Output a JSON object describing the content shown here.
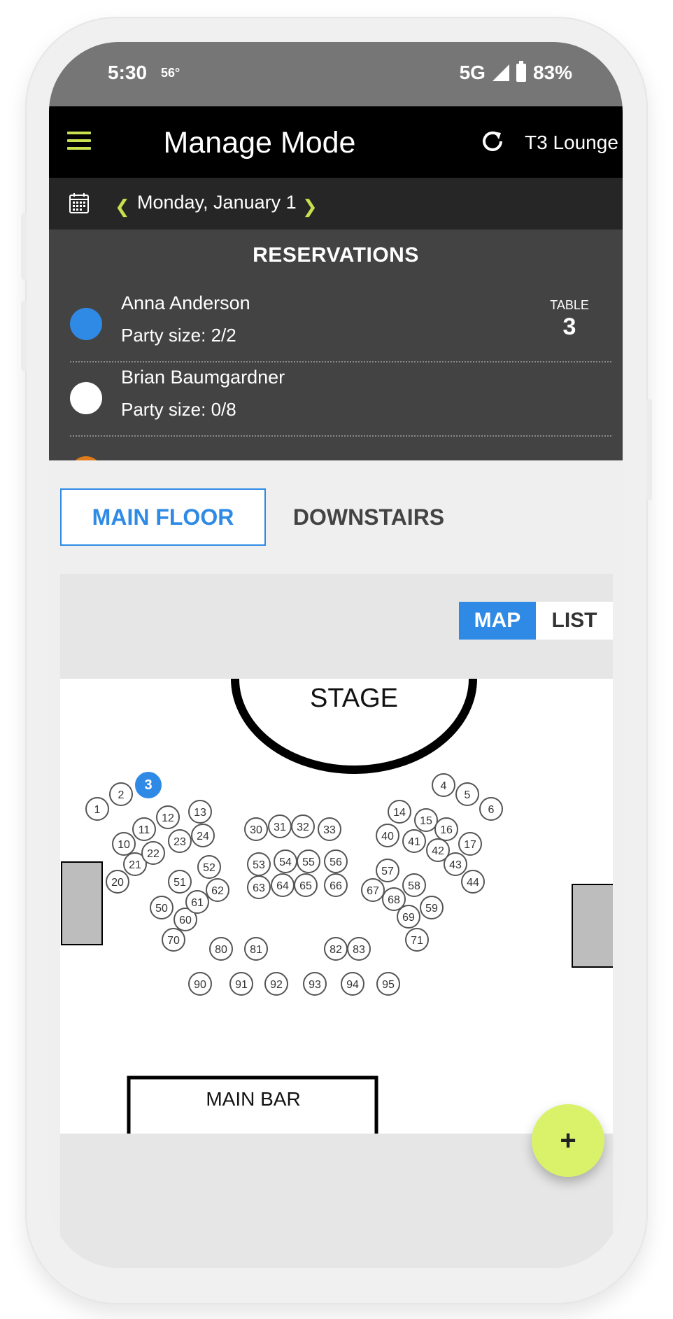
{
  "status": {
    "time": "5:30",
    "temp": "56°",
    "network": "5G",
    "battery": "83%"
  },
  "appbar": {
    "title": "Manage Mode",
    "venue": "T3 Lounge"
  },
  "datebar": {
    "date": "Monday, January 1"
  },
  "reservations": {
    "title": "RESERVATIONS",
    "items": [
      {
        "name": "Anna Anderson",
        "party": "Party size: 2/2",
        "table_label": "TABLE",
        "table": "3",
        "color": "#2f8ae6"
      },
      {
        "name": "Brian Baumgardner",
        "party": "Party size: 0/8",
        "table_label": "",
        "table": "",
        "color": "#ffffff"
      },
      {
        "name": "",
        "party": "",
        "table_label": "",
        "table": "",
        "color": "#e07b1a"
      }
    ]
  },
  "floor_tabs": {
    "main": "MAIN FLOOR",
    "downstairs": "DOWNSTAIRS"
  },
  "view_toggle": {
    "map": "MAP",
    "list": "LIST"
  },
  "floor_plan": {
    "stage_label": "STAGE",
    "bar_label": "MAIN BAR",
    "highlighted_table": "3",
    "tables": [
      "1",
      "2",
      "3",
      "4",
      "5",
      "6",
      "10",
      "11",
      "12",
      "13",
      "14",
      "15",
      "16",
      "17",
      "20",
      "21",
      "22",
      "23",
      "24",
      "30",
      "31",
      "32",
      "33",
      "40",
      "41",
      "42",
      "43",
      "44",
      "50",
      "51",
      "52",
      "53",
      "54",
      "55",
      "56",
      "57",
      "58",
      "59",
      "60",
      "61",
      "62",
      "63",
      "64",
      "65",
      "66",
      "67",
      "68",
      "69",
      "70",
      "71",
      "80",
      "81",
      "82",
      "83",
      "90",
      "91",
      "92",
      "93",
      "94",
      "95"
    ]
  },
  "fab": {
    "label": "+"
  },
  "colors": {
    "accent": "#2f8ae6",
    "brand": "#c6e04f",
    "fab": "#d9f26a"
  }
}
